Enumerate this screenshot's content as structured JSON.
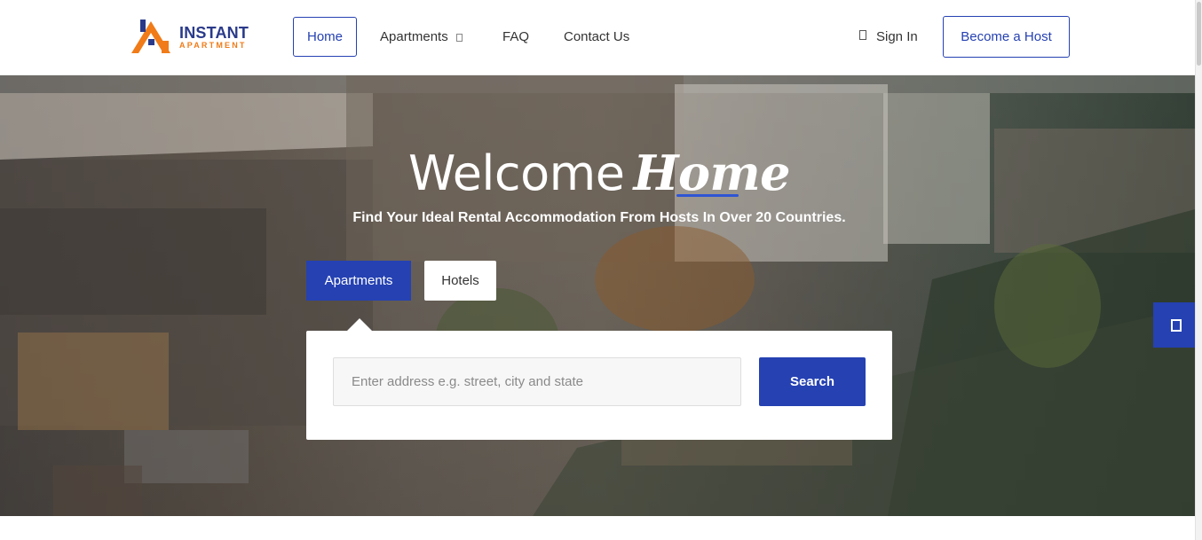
{
  "brand": {
    "logo_main": "INSTANT",
    "logo_sub": "APARTMENT",
    "colors": {
      "primary": "#2541b2",
      "accent": "#f07b18"
    }
  },
  "nav": {
    "home": "Home",
    "apartments": "Apartments",
    "faq": "FAQ",
    "contact": "Contact Us",
    "sign_in": "Sign In",
    "become_host": "Become a Host"
  },
  "hero": {
    "welcome": "Welcome",
    "welcome_script": "Home",
    "tagline": "Find Your Ideal Rental Accommodation From Hosts In Over 20 Countries."
  },
  "search": {
    "tabs": [
      "Apartments",
      "Hotels"
    ],
    "active_tab": "Apartments",
    "placeholder": "Enter address e.g. street, city and state",
    "button": "Search"
  },
  "icons": {
    "apartments_dropdown": "chevron-down-icon",
    "sign_in": "user-icon",
    "side_widget": "document-icon"
  }
}
